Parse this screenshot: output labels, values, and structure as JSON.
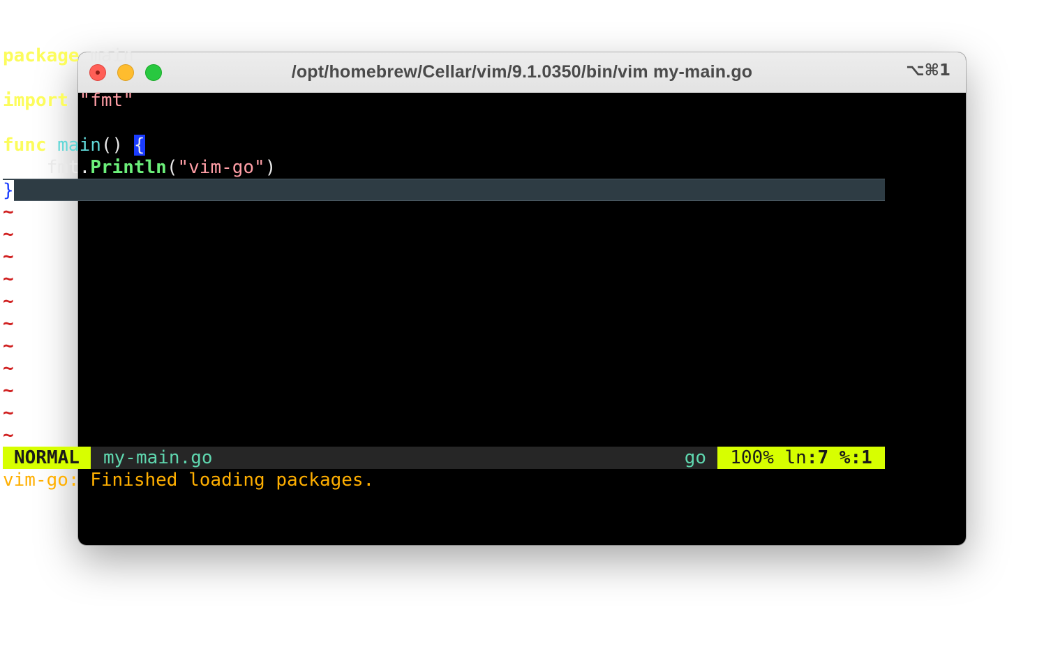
{
  "window": {
    "title": "/opt/homebrew/Cellar/vim/9.1.0350/bin/vim my-main.go",
    "shortcut": "⌥⌘1"
  },
  "editor": {
    "lines": [
      {
        "kw": "package",
        "rest": " main"
      },
      {
        "text": ""
      },
      {
        "kw": "import",
        "sp": " ",
        "str": "\"fmt\""
      },
      {
        "text": ""
      },
      {
        "kw": "func",
        "sp": " ",
        "fn": "main",
        "parens": "() ",
        "brace": "{"
      },
      {
        "indent": "    ",
        "pkg": "fmt.",
        "method": "Println",
        "open": "(",
        "str": "\"vim-go\"",
        "close": ")"
      },
      {
        "cursor_char": "}"
      }
    ],
    "tilde": "~",
    "tilde_count": 11
  },
  "statusline": {
    "mode": "NORMAL",
    "filename": "my-main.go",
    "filetype": "go",
    "percent": "100%",
    "line_label": "ln",
    "line_num": ":7",
    "col_label": "%:1"
  },
  "message": "vim-go: Finished loading packages.",
  "colors": {
    "keyword": "#fcfc5c",
    "string": "#ff9ea6",
    "function": "#5fd7d7",
    "method": "#6cf07a",
    "mode_bg": "#d7ff00",
    "tilde": "#d02020",
    "message": "#ffaf00"
  }
}
